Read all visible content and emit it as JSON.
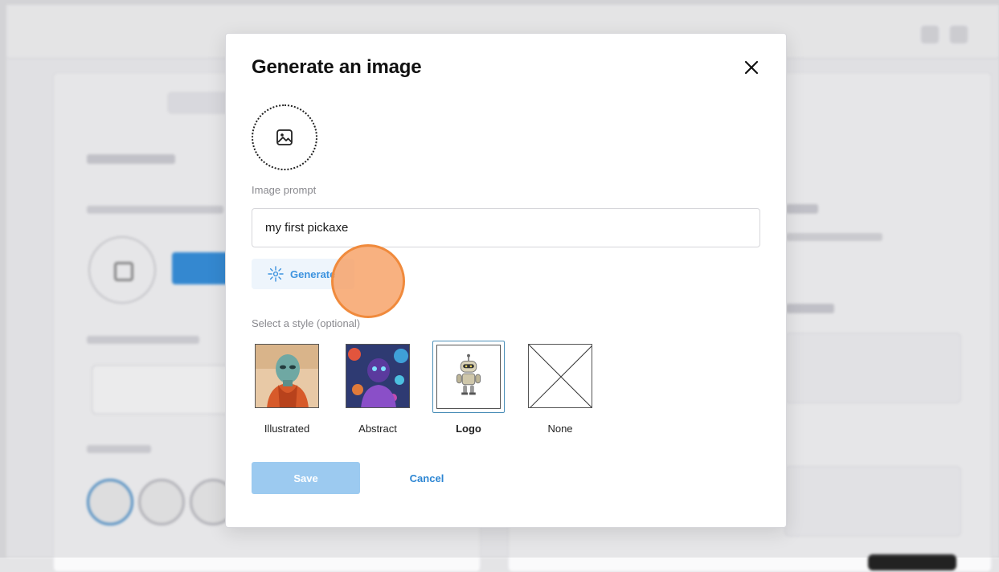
{
  "modal": {
    "title": "Generate an image",
    "close_icon": "close-icon",
    "image_placeholder_icon": "image-icon",
    "prompt_label": "Image prompt",
    "prompt_value": "my first pickaxe",
    "generate_label": "Generate",
    "generate_icon": "sparkle-icon",
    "style_label": "Select a style (optional)",
    "styles": [
      {
        "label": "Illustrated",
        "selected": false
      },
      {
        "label": "Abstract",
        "selected": false
      },
      {
        "label": "Logo",
        "selected": true
      },
      {
        "label": "None",
        "selected": false
      }
    ],
    "save_label": "Save",
    "cancel_label": "Cancel"
  },
  "colors": {
    "accent": "#3d93df",
    "save_disabled": "#9ccaf0",
    "selected_border": "#4b8fb8",
    "click_indicator": "#f08a3c"
  }
}
